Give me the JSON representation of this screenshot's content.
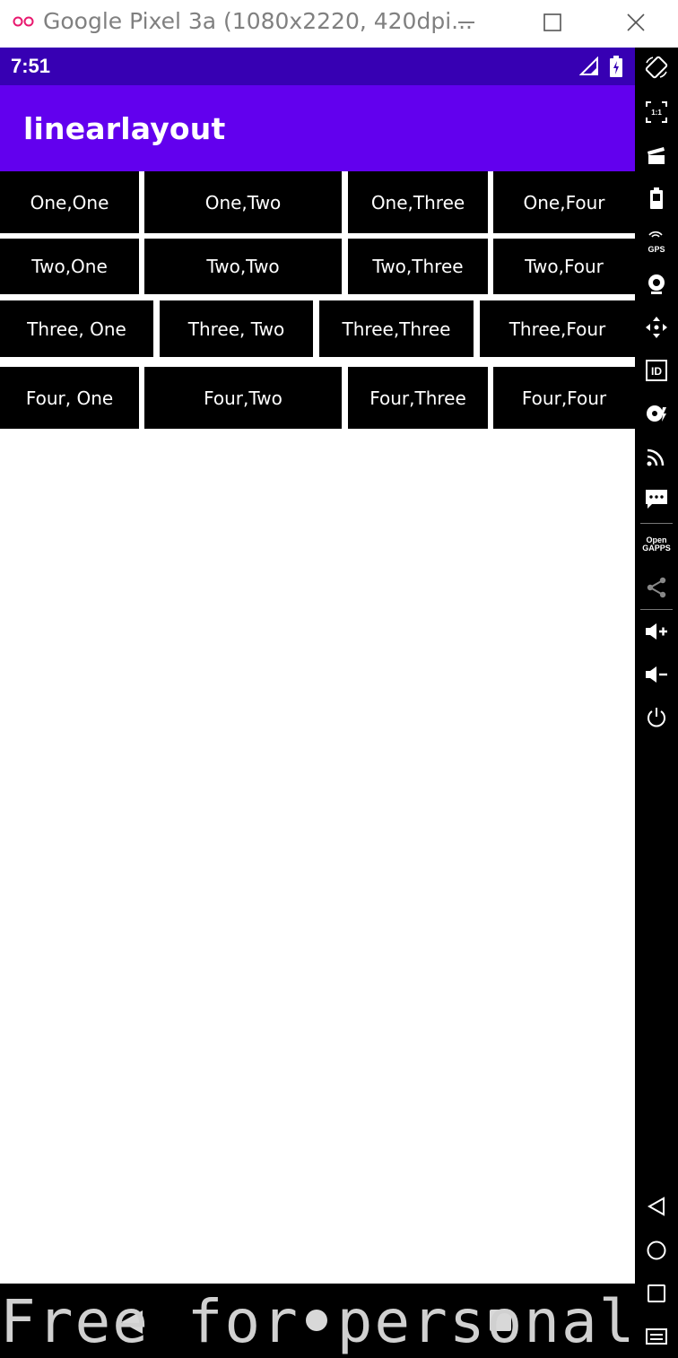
{
  "window": {
    "title": "Google Pixel 3a (1080x2220, 420dpi..."
  },
  "statusbar": {
    "time": "7:51"
  },
  "appbar": {
    "title": "linearlayout"
  },
  "grid": {
    "rows": [
      [
        "One,One",
        "One,Two",
        "One,Three",
        "One,Four"
      ],
      [
        "Two,One",
        "Two,Two",
        "Two,Three",
        "Two,Four"
      ],
      [
        "Three, One",
        "Three, Two",
        "Three,Three",
        "Three,Four"
      ],
      [
        "Four, One",
        "Four,Two",
        "Four,Three",
        "Four,Four"
      ]
    ]
  },
  "watermark": {
    "text": "Free for personal use"
  },
  "sidebar": {
    "ratio_label": "1:1",
    "gps_label": "GPS",
    "id_label": "ID",
    "opengapps_label": "Open GAPPS"
  },
  "colors": {
    "status_bar": "#3700b3",
    "app_bar": "#6200ee",
    "cell_bg": "#000000",
    "cell_text": "#ffffff"
  },
  "icons": [
    "logo-icon",
    "minimize-icon",
    "maximize-icon",
    "close-icon",
    "signal-icon",
    "battery-icon",
    "rotate-icon",
    "fit-screen-icon",
    "screen-record-icon",
    "battery-setting-icon",
    "gps-icon",
    "webcam-icon",
    "dpad-icon",
    "id-icon",
    "media-icon",
    "cast-icon",
    "sms-icon",
    "opengapps-icon",
    "share-icon",
    "volume-up-icon",
    "volume-down-icon",
    "power-icon",
    "back-icon",
    "home-icon",
    "recents-icon",
    "menu-icon"
  ]
}
